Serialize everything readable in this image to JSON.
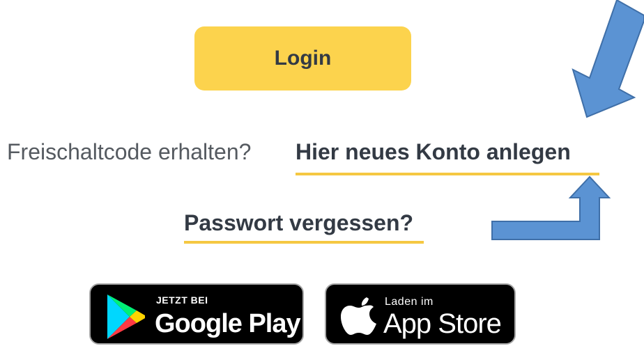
{
  "login": {
    "label": "Login"
  },
  "register": {
    "prompt": "Freischaltcode erhalten?",
    "link_label": "Hier neues Konto anlegen"
  },
  "forgot_password": {
    "label": "Passwort vergessen?"
  },
  "stores": {
    "google_play": {
      "small": "JETZT BEI",
      "big": "Google Play",
      "icon": "google-play-icon"
    },
    "app_store": {
      "small": "Laden im",
      "big": "App Store",
      "icon": "apple-icon"
    }
  },
  "colors": {
    "accent": "#fcd34d",
    "underline": "#f5c842",
    "text_dark": "#333a44",
    "text_muted": "#555a60",
    "annotation_arrow": "#5b93d3"
  }
}
